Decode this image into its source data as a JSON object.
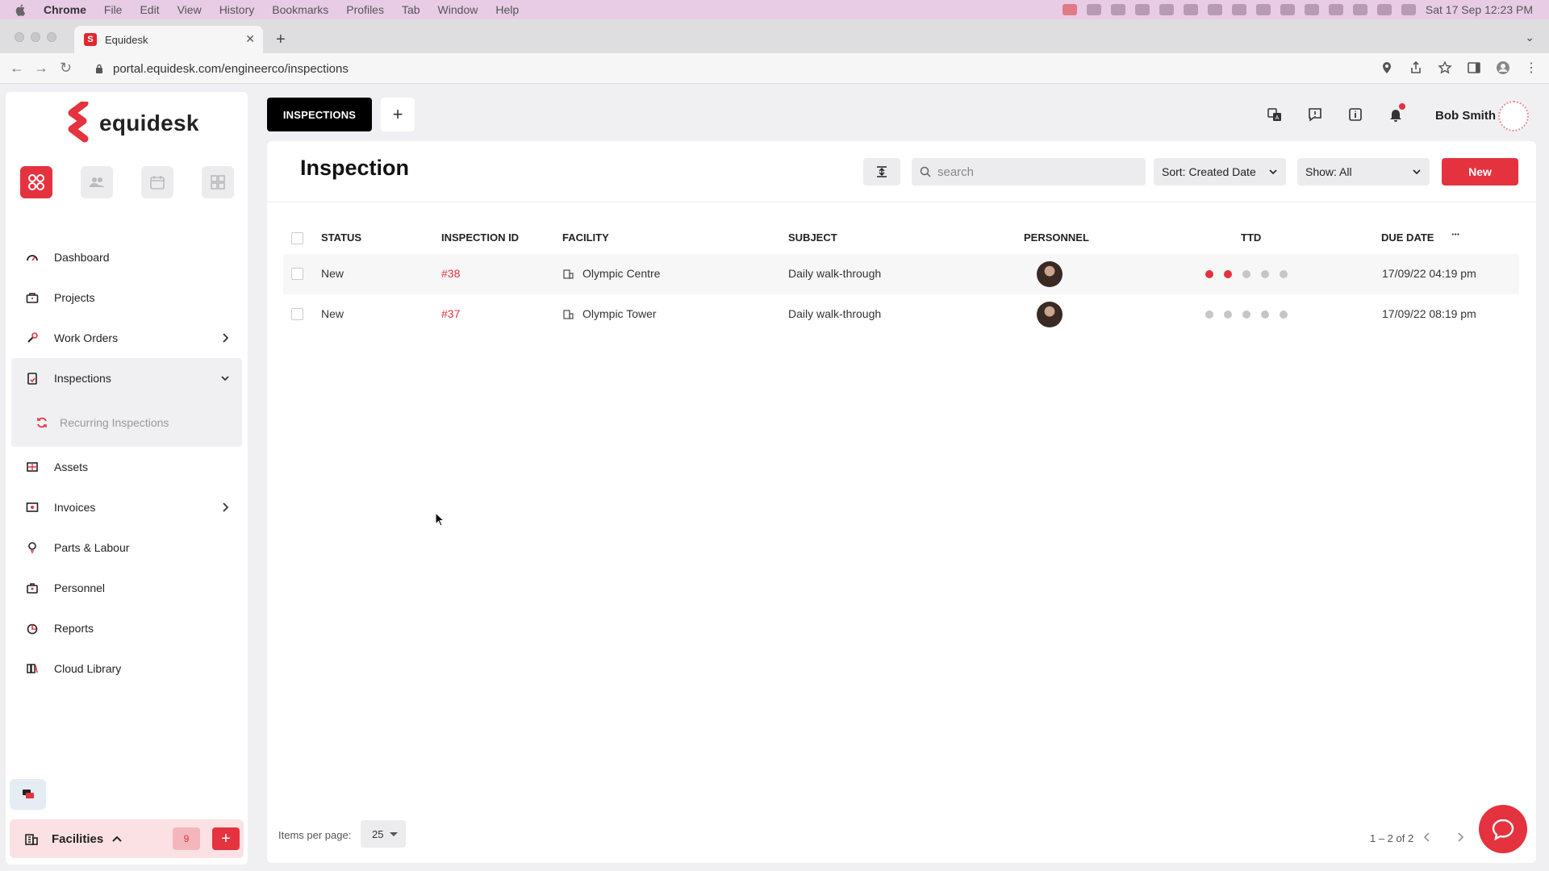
{
  "menubar": {
    "app": "Chrome",
    "items": [
      "File",
      "Edit",
      "View",
      "History",
      "Bookmarks",
      "Profiles",
      "Tab",
      "Window",
      "Help"
    ],
    "clock": "Sat 17 Sep  12:23 PM"
  },
  "browser": {
    "tab_title": "Equidesk",
    "url": "portal.equidesk.com/engineerco/inspections"
  },
  "brand": {
    "name": "equidesk",
    "accent": "#e5323f"
  },
  "sidebar": {
    "items": [
      {
        "label": "Dashboard",
        "icon": "dashboard-icon"
      },
      {
        "label": "Projects",
        "icon": "briefcase-icon"
      },
      {
        "label": "Work Orders",
        "icon": "wrench-icon"
      },
      {
        "label": "Inspections",
        "icon": "clipboard-icon"
      },
      {
        "label": "Assets",
        "icon": "assets-icon"
      },
      {
        "label": "Invoices",
        "icon": "invoice-icon"
      },
      {
        "label": "Parts & Labour",
        "icon": "bulb-icon"
      },
      {
        "label": "Personnel",
        "icon": "person-badge-icon"
      },
      {
        "label": "Reports",
        "icon": "chart-pie-icon"
      },
      {
        "label": "Cloud Library",
        "icon": "library-icon"
      }
    ],
    "sub_item": "Recurring Inspections",
    "facilities_label": "Facilities",
    "facilities_count": "9"
  },
  "header": {
    "tab_label": "INSPECTIONS",
    "user_name": "Bob Smith"
  },
  "main": {
    "title": "Inspection",
    "search_placeholder": "search",
    "sort_label": "Sort: Created Date",
    "show_label": "Show: All",
    "new_button": "New",
    "columns": [
      "STATUS",
      "INSPECTION ID",
      "FACILITY",
      "SUBJECT",
      "PERSONNEL",
      "TTD",
      "DUE DATE"
    ],
    "more_glyph": "···",
    "rows": [
      {
        "status": "New",
        "id": "#38",
        "facility": "Olympic Centre",
        "subject": "Daily walk-through",
        "ttd_filled": 2,
        "ttd_total": 5,
        "due": "17/09/22 04:19 pm"
      },
      {
        "status": "New",
        "id": "#37",
        "facility": "Olympic Tower",
        "subject": "Daily walk-through",
        "ttd_filled": 0,
        "ttd_total": 5,
        "due": "17/09/22 08:19 pm"
      }
    ],
    "items_per_page_label": "Items per page:",
    "items_per_page": "25",
    "range": "1 – 2 of 2"
  }
}
